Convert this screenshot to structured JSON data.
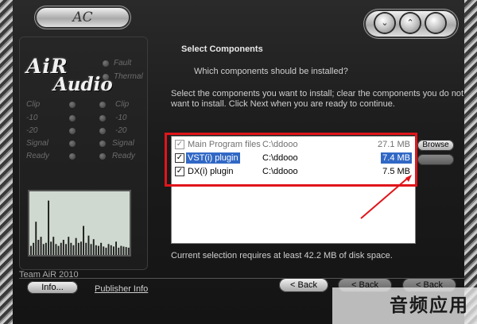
{
  "window": {
    "logo_pill_text": "AC",
    "controls": {
      "minimize": "⌄",
      "maximize": "⌃",
      "close": ""
    }
  },
  "branding": {
    "line1": "AiR",
    "line2": "Audio"
  },
  "meter_labels": {
    "right": [
      "Fault",
      "Thermal",
      "Clip",
      "-10",
      "-20",
      "Signal",
      "Ready"
    ],
    "left": [
      "Clip",
      "-10",
      "-20",
      "Signal",
      "Ready"
    ]
  },
  "meter_levels": [
    0.15,
    0.2,
    0.55,
    0.25,
    0.3,
    0.18,
    0.2,
    0.9,
    0.22,
    0.3,
    0.18,
    0.15,
    0.2,
    0.25,
    0.18,
    0.3,
    0.2,
    0.16,
    0.28,
    0.2,
    0.22,
    0.48,
    0.2,
    0.32,
    0.18,
    0.26,
    0.16,
    0.15,
    0.2,
    0.14,
    0.12,
    0.18,
    0.16,
    0.14,
    0.22,
    0.12,
    0.15,
    0.14,
    0.13,
    0.12
  ],
  "footer_left": {
    "team": "Team AiR 2010",
    "info_button": "Info...",
    "publisher_link": "Publisher Info"
  },
  "page": {
    "heading": "Select Components",
    "subheading": "Which components should be installed?",
    "description": "Select the components you want to install; clear the components you do not want to install. Click Next when you are ready to continue."
  },
  "components": [
    {
      "name": "Main Program files",
      "path": "C:\\ddooo",
      "size": "27.1 MB",
      "checked": true,
      "disabled": true,
      "selected": false
    },
    {
      "name": "VST(i) plugin",
      "path": "C:\\ddooo",
      "size": "7.4 MB",
      "checked": true,
      "disabled": false,
      "selected": true
    },
    {
      "name": "DX(i) plugin",
      "path": "C:\\ddooo",
      "size": "7.5 MB",
      "checked": true,
      "disabled": false,
      "selected": false
    }
  ],
  "buttons": {
    "browse": "Browse",
    "back": "< Back",
    "back_ghost_1": "< Back",
    "back_ghost_2": "< Back"
  },
  "status": "Current selection requires at least 42.2 MB of disk space.",
  "watermark": "音频应用",
  "colors": {
    "highlight": "#e0151b",
    "selection": "#3168c5"
  }
}
